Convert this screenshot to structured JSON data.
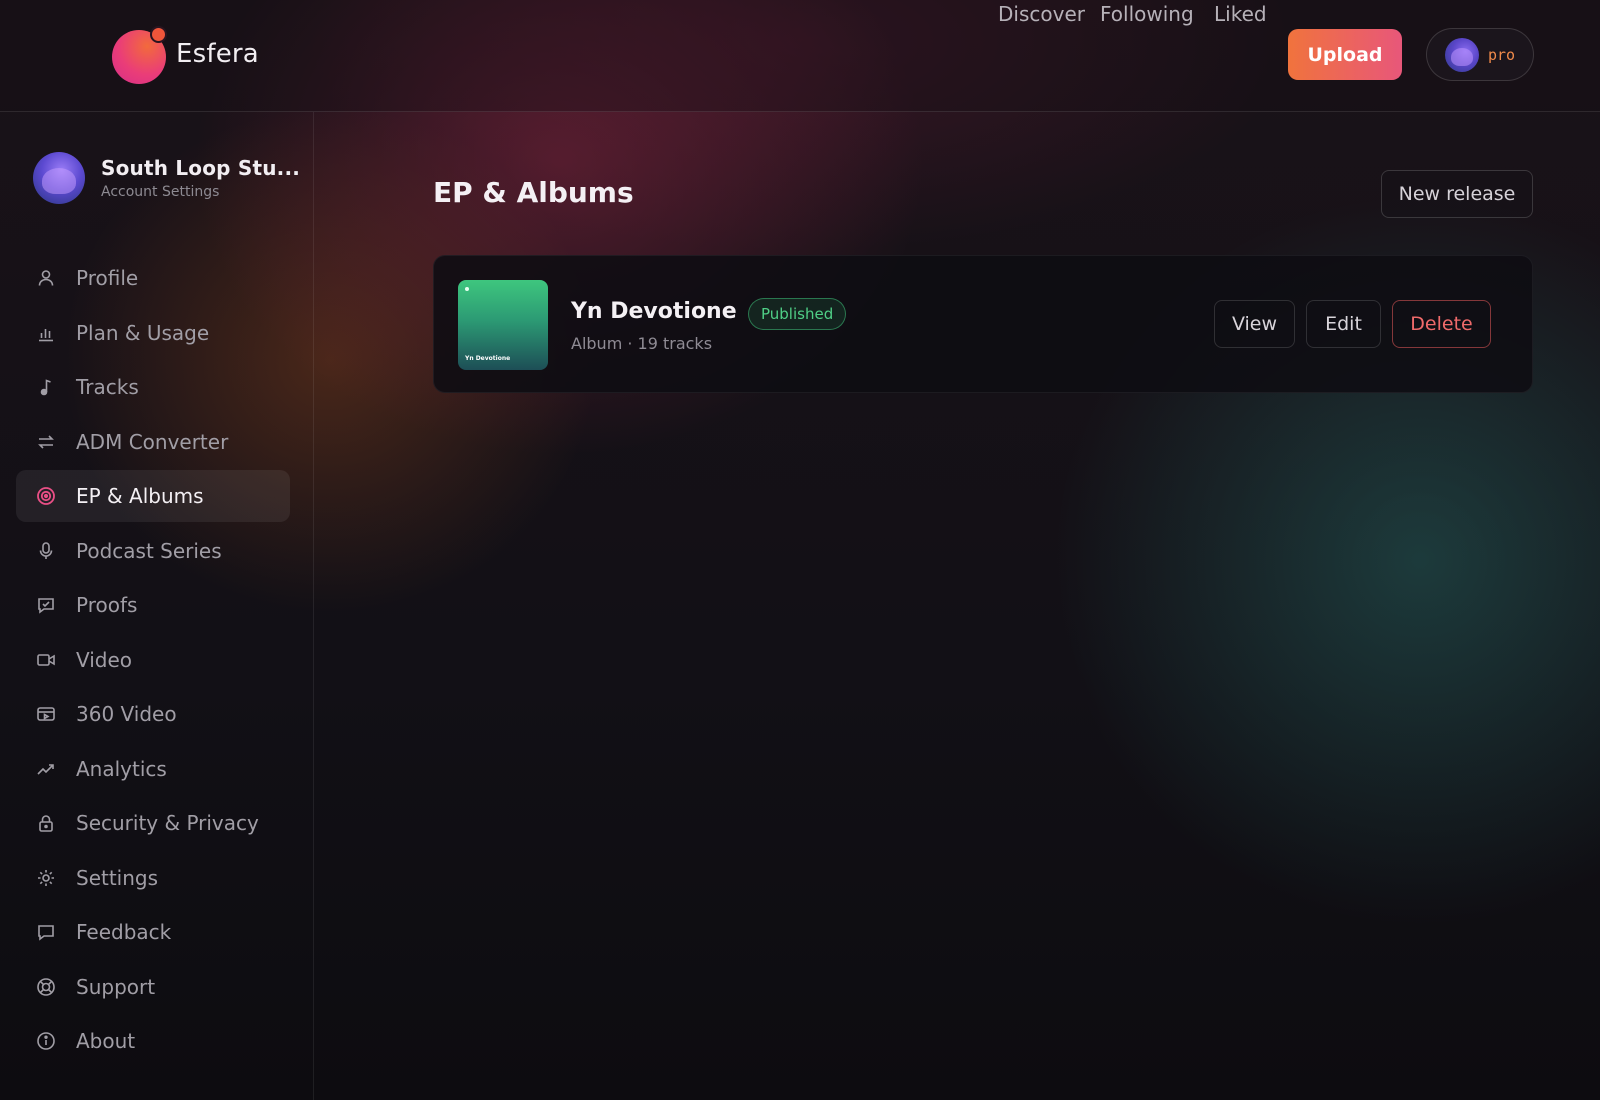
{
  "app": {
    "name": "Esfera"
  },
  "topnav": {
    "links": [
      "Discover",
      "Following",
      "Liked"
    ],
    "upload_label": "Upload",
    "plan_label": "pro"
  },
  "account": {
    "name": "South Loop Stu...",
    "subtitle": "Account Settings"
  },
  "sidebar": {
    "items": [
      {
        "label": "Profile",
        "icon": "user-icon"
      },
      {
        "label": "Plan & Usage",
        "icon": "bar-chart-icon"
      },
      {
        "label": "Tracks",
        "icon": "music-note-icon"
      },
      {
        "label": "ADM Converter",
        "icon": "swap-arrows-icon"
      },
      {
        "label": "EP & Albums",
        "icon": "target-icon",
        "active": true
      },
      {
        "label": "Podcast Series",
        "icon": "microphone-icon"
      },
      {
        "label": "Proofs",
        "icon": "chat-check-icon"
      },
      {
        "label": "Video",
        "icon": "video-camera-icon"
      },
      {
        "label": "360 Video",
        "icon": "video-360-icon"
      },
      {
        "label": "Analytics",
        "icon": "trend-up-icon"
      },
      {
        "label": "Security & Privacy",
        "icon": "lock-icon"
      },
      {
        "label": "Settings",
        "icon": "gear-icon"
      },
      {
        "label": "Feedback",
        "icon": "chat-bubble-icon"
      },
      {
        "label": "Support",
        "icon": "lifebuoy-icon"
      },
      {
        "label": "About",
        "icon": "info-icon"
      }
    ]
  },
  "main": {
    "title": "EP & Albums",
    "new_release_label": "New release",
    "releases": [
      {
        "title": "Yn Devotione",
        "status": "Published",
        "meta": "Album · 19 tracks",
        "cover_text": "Yn Devotione",
        "actions": {
          "view": "View",
          "edit": "Edit",
          "delete": "Delete"
        }
      }
    ]
  },
  "colors": {
    "accent_orange": "#f0733d",
    "accent_pink": "#e8577a",
    "published_green": "#4fcf86",
    "delete_red": "#ef6a6a",
    "active_icon": "#ea4f86"
  }
}
